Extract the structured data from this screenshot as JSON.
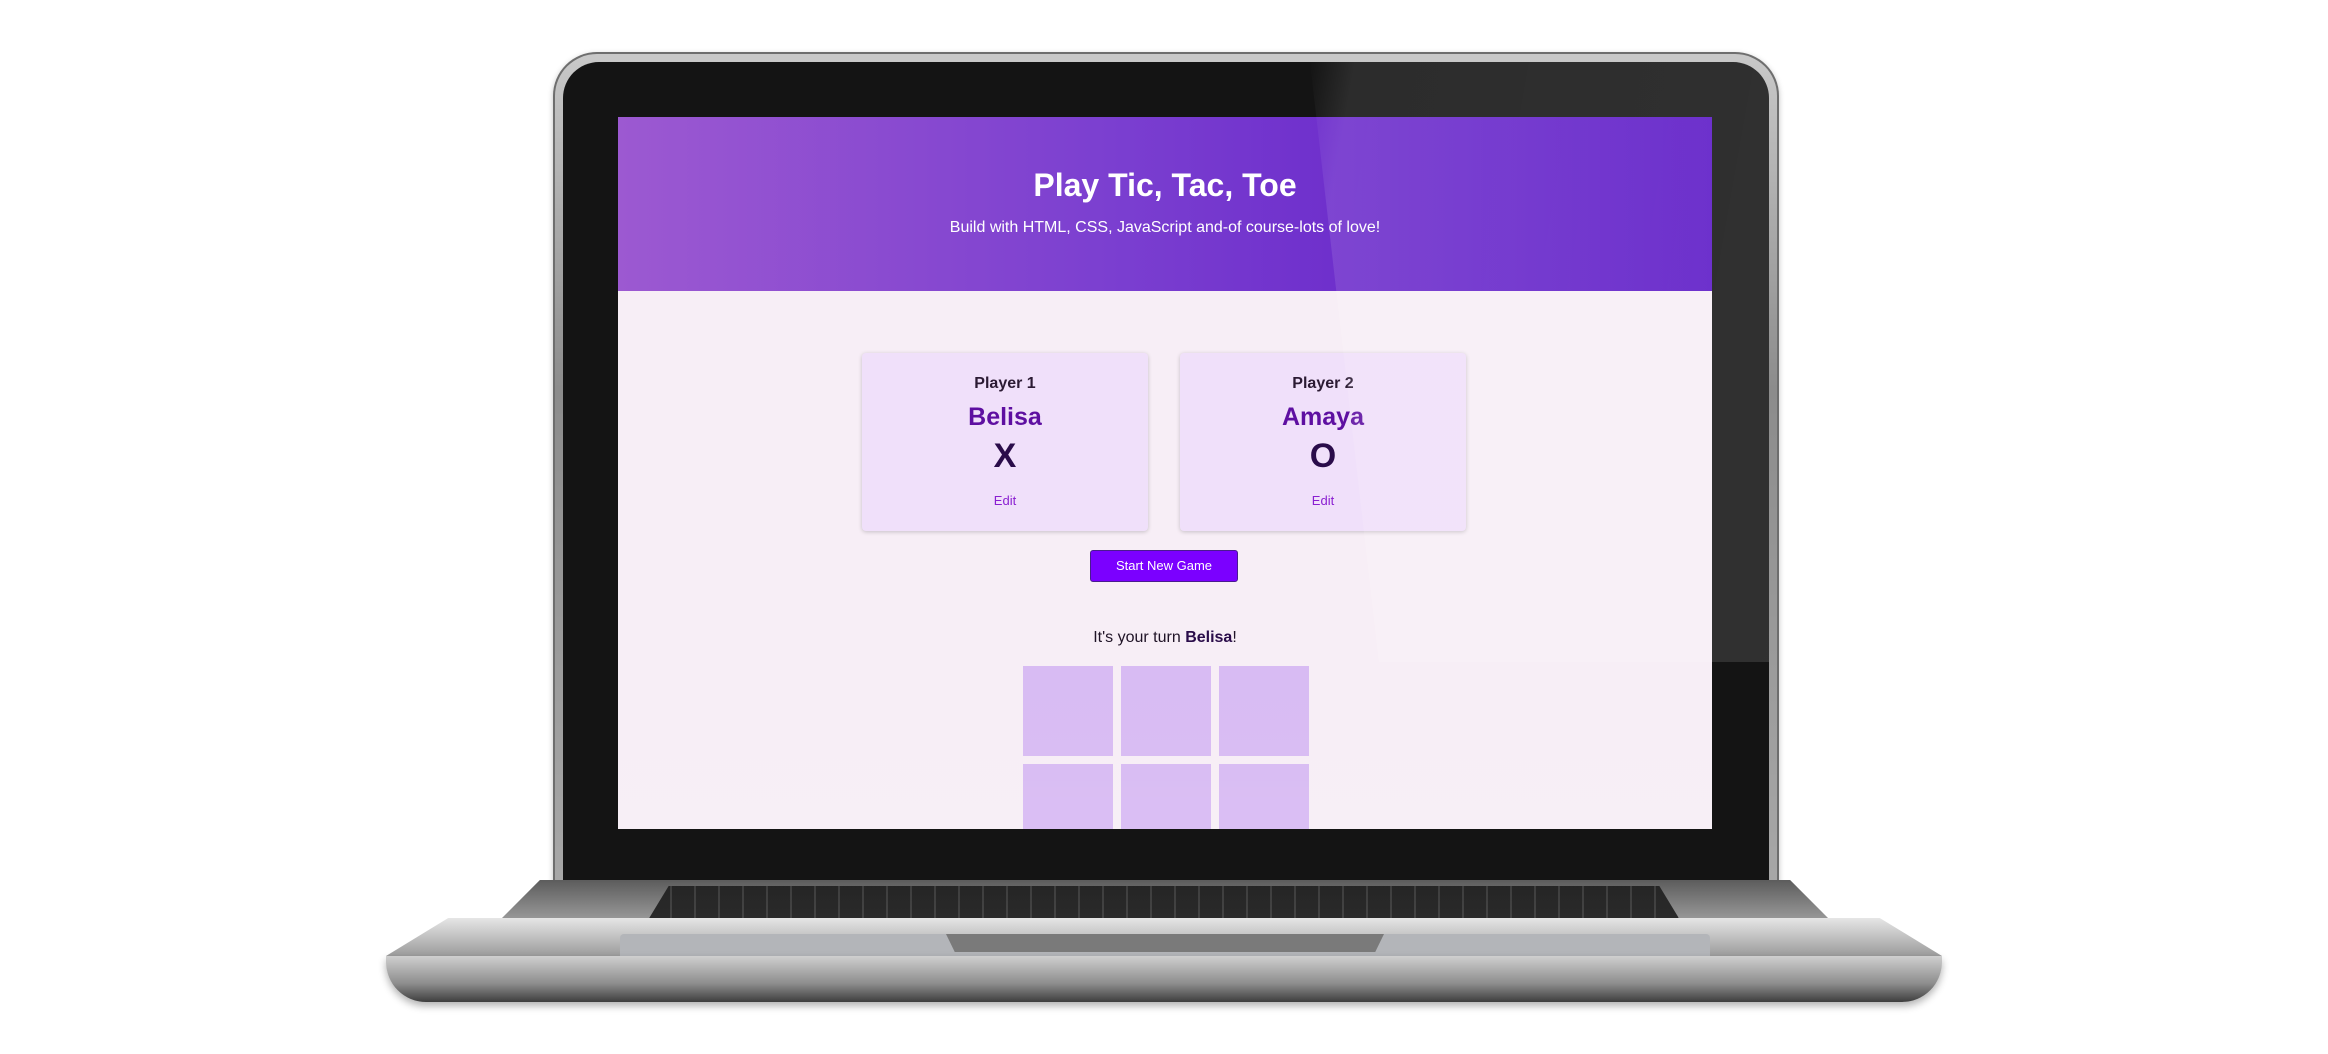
{
  "header": {
    "title": "Play Tic, Tac, Toe",
    "subtitle": "Build with HTML, CSS, JavaScript and-of course-lots of love!"
  },
  "players": [
    {
      "label": "Player 1",
      "name": "Belisa",
      "symbol": "X",
      "edit_label": "Edit"
    },
    {
      "label": "Player 2",
      "name": "Amaya",
      "symbol": "O",
      "edit_label": "Edit"
    }
  ],
  "controls": {
    "start_label": "Start New Game"
  },
  "turn": {
    "prefix": "It's your turn ",
    "player": "Belisa",
    "suffix": "!"
  },
  "board": {
    "cells": [
      "",
      "",
      "",
      "",
      "",
      "",
      "",
      "",
      ""
    ]
  },
  "colors": {
    "header_start": "#9c59d1",
    "header_end": "#5a16c6",
    "accent": "#7b00ff",
    "card_bg": "#f0e0fa",
    "cell_bg": "#d8bbf3",
    "page_bg": "#f7eef6"
  }
}
